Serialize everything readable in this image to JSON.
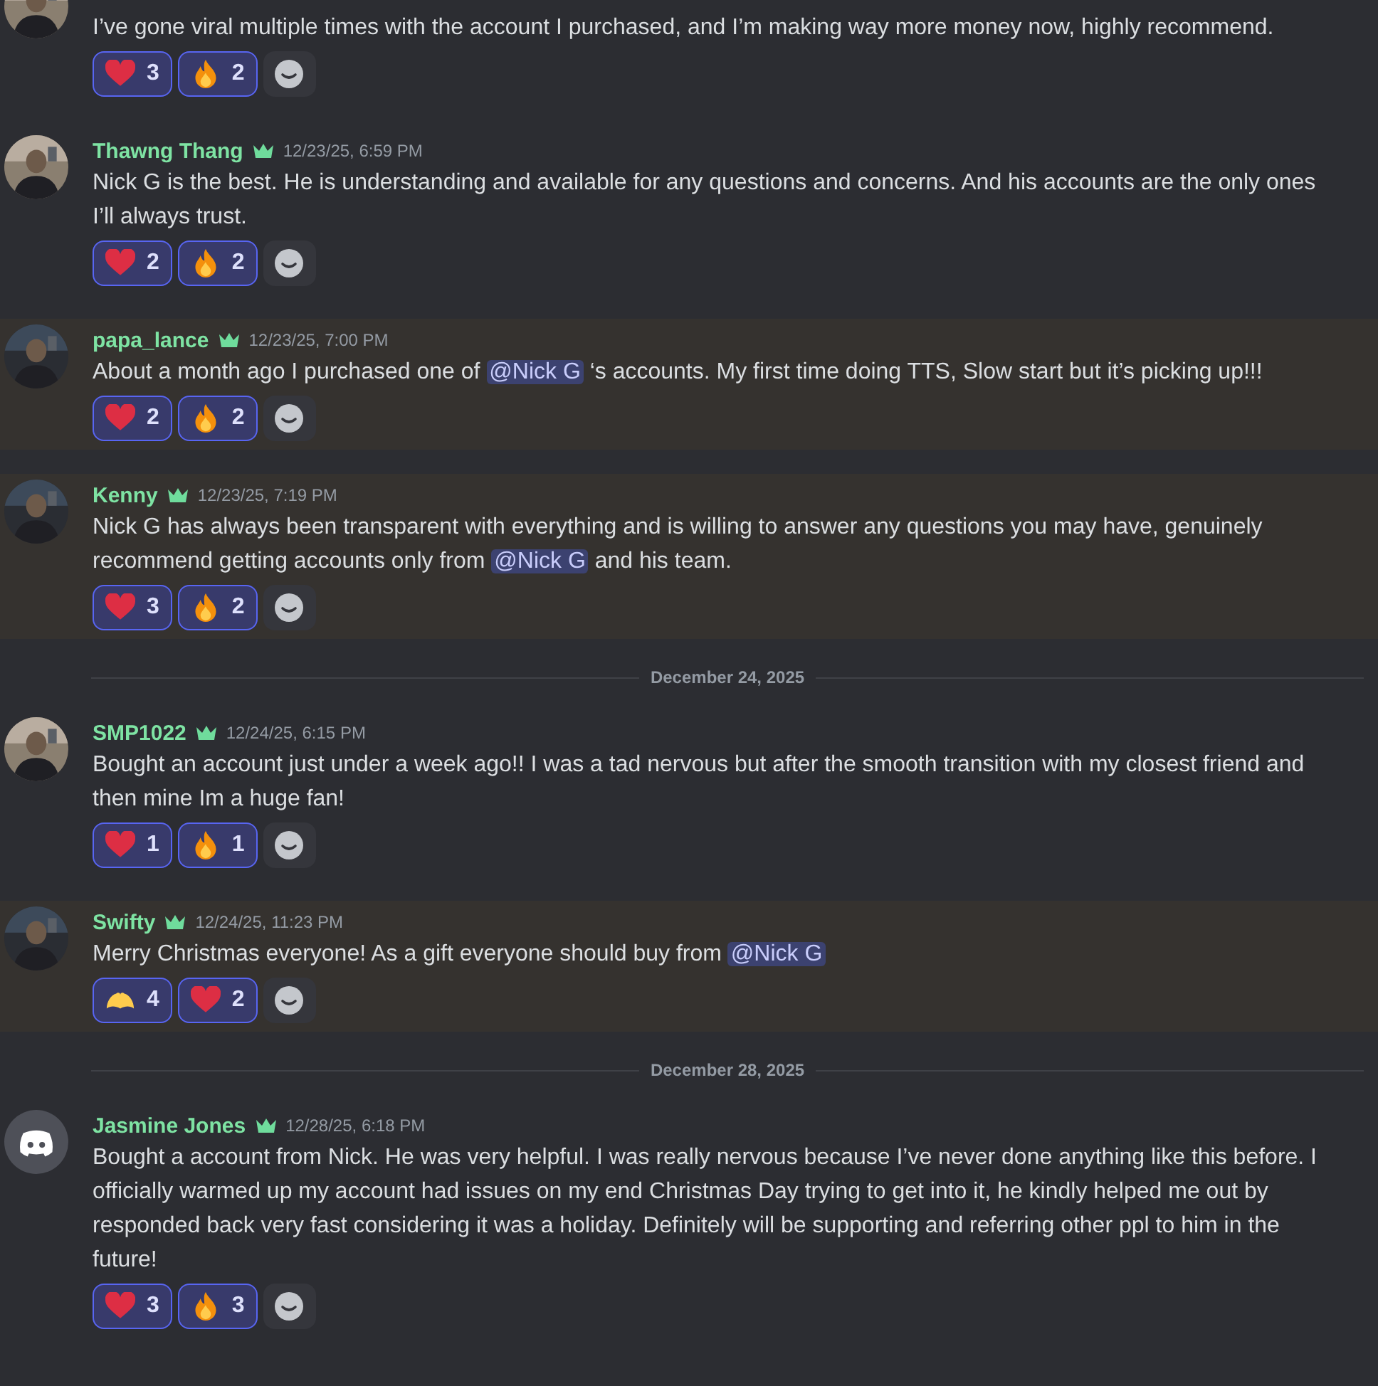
{
  "feed": [
    {
      "kind": "message",
      "highlighted": false,
      "avatar": {
        "kind": "picture"
      },
      "body": [
        {
          "text": "I’ve gone viral multiple times with the account I purchased, and I’m making way more money now, highly recommend."
        }
      ],
      "reactions": [
        {
          "kind": "heart",
          "count": "3",
          "selected": true
        },
        {
          "kind": "fire",
          "count": "2",
          "selected": true
        }
      ]
    },
    {
      "kind": "message",
      "highlighted": false,
      "avatar": {
        "kind": "picture"
      },
      "author": "Thawng Thang",
      "time": "12/23/25, 6:59 PM",
      "body": [
        {
          "text": "Nick G is the best. He is understanding and available for any questions and concerns. And his accounts are the only ones I’ll always trust."
        }
      ],
      "reactions": [
        {
          "kind": "heart",
          "count": "2",
          "selected": true
        },
        {
          "kind": "fire",
          "count": "2",
          "selected": true
        }
      ]
    },
    {
      "kind": "message",
      "highlighted": true,
      "avatar": {
        "kind": "picture"
      },
      "author": "papa_lance",
      "time": "12/23/25, 7:00 PM",
      "body": [
        {
          "text": "About a month ago I purchased one of "
        },
        {
          "mention": "@Nick G"
        },
        {
          "text": " ‘s accounts. My first time doing TTS, Slow start but it’s picking up!!!"
        }
      ],
      "reactions": [
        {
          "kind": "heart",
          "count": "2",
          "selected": true
        },
        {
          "kind": "fire",
          "count": "2",
          "selected": true
        }
      ]
    },
    {
      "kind": "message",
      "highlighted": true,
      "avatar": {
        "kind": "picture"
      },
      "author": "Kenny",
      "time": "12/23/25, 7:19 PM",
      "body": [
        {
          "text": "Nick G has always been transparent with everything and is willing to answer any questions you may have, genuinely recommend getting accounts only from "
        },
        {
          "mention": "@Nick G"
        },
        {
          "text": " and his team."
        }
      ],
      "reactions": [
        {
          "kind": "heart",
          "count": "3",
          "selected": true
        },
        {
          "kind": "fire",
          "count": "2",
          "selected": true
        }
      ]
    },
    {
      "kind": "divider",
      "label": "December 24, 2025"
    },
    {
      "kind": "message",
      "highlighted": false,
      "avatar": {
        "kind": "picture"
      },
      "author": "SMP1022",
      "time": "12/24/25, 6:15 PM",
      "body": [
        {
          "text": "Bought an account just under a week ago!! I was a tad nervous but after the smooth transition with my closest friend and then mine Im a huge fan!"
        }
      ],
      "reactions": [
        {
          "kind": "heart",
          "count": "1",
          "selected": true
        },
        {
          "kind": "fire",
          "count": "1",
          "selected": true
        }
      ]
    },
    {
      "kind": "message",
      "highlighted": true,
      "avatar": {
        "kind": "picture"
      },
      "author": "Swifty",
      "time": "12/24/25, 11:23 PM",
      "body": [
        {
          "text": "Merry Christmas everyone! As a gift everyone should buy from "
        },
        {
          "mention": "@Nick G"
        }
      ],
      "reactions": [
        {
          "kind": "hands",
          "count": "4",
          "selected": true
        },
        {
          "kind": "heart",
          "count": "2",
          "selected": true
        }
      ]
    },
    {
      "kind": "divider",
      "label": "December 28, 2025"
    },
    {
      "kind": "message",
      "highlighted": false,
      "avatar": {
        "kind": "default"
      },
      "author": "Jasmine Jones",
      "time": "12/28/25, 6:18 PM",
      "body": [
        {
          "text": "Bought a account from Nick. He was very helpful. I was really nervous because I’ve never done anything like this before. I officially warmed up my account had issues on my end Christmas Day trying to get into it, he kindly helped me out by responded back very fast considering it was a holiday. Definitely will be supporting and referring other ppl to him in the future!"
        }
      ],
      "reactions": [
        {
          "kind": "heart",
          "count": "3",
          "selected": true
        },
        {
          "kind": "fire",
          "count": "3",
          "selected": true
        }
      ]
    }
  ]
}
